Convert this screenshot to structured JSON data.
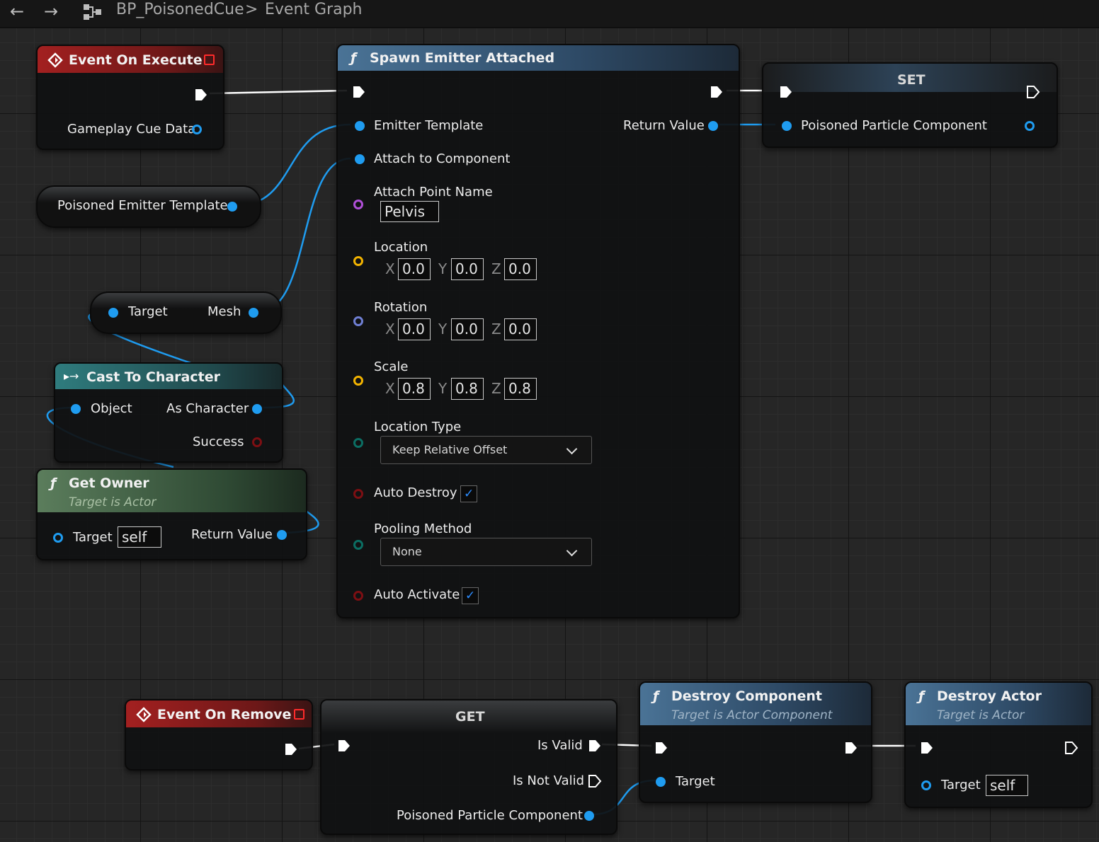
{
  "toolbar": {
    "back_icon": "arrow-left-icon",
    "forward_icon": "arrow-right-icon",
    "graph_icon": "blueprint-graph-icon",
    "blueprint": "BP_PoisonedCue",
    "separator": ">",
    "graph": "Event Graph"
  },
  "colors": {
    "event_header": "#8d1d1d",
    "function_header": "#3b5f7d",
    "pure_header": "#47604a",
    "cast_header": "#2f6a6c",
    "exec_pin": "#ffffff",
    "object_pin": "#1f9cf0",
    "vector_pin": "#f2b300",
    "rotator_pin": "#6f7fd3",
    "name_pin": "#b04fd8",
    "bool_pin": "#7d0f13",
    "enum_pin": "#0b6e63"
  },
  "event_exec": {
    "title": "Event On Execute",
    "pin": "Gameplay Cue Data"
  },
  "var_emitter": {
    "label": "Poisoned Emitter Template"
  },
  "mesh_node": {
    "target": "Target",
    "mesh": "Mesh"
  },
  "cast": {
    "title": "Cast To Character",
    "object": "Object",
    "as_character": "As Character",
    "success": "Success"
  },
  "get_owner": {
    "title": "Get Owner",
    "subtitle": "Target is Actor",
    "target": "Target",
    "target_value": "self",
    "return": "Return Value"
  },
  "spawn": {
    "title": "Spawn Emitter Attached",
    "emitter_template": "Emitter Template",
    "attach_component": "Attach to Component",
    "attach_point": "Attach Point Name",
    "attach_point_value": "Pelvis",
    "return": "Return Value",
    "axis_x": "X",
    "axis_y": "Y",
    "axis_z": "Z",
    "location": "Location",
    "loc_x": "0.0",
    "loc_y": "0.0",
    "loc_z": "0.0",
    "rotation": "Rotation",
    "rot_x": "0.0",
    "rot_y": "0.0",
    "rot_z": "0.0",
    "scale": "Scale",
    "sc_x": "0.8",
    "sc_y": "0.8",
    "sc_z": "0.8",
    "location_type": "Location Type",
    "location_type_value": "Keep Relative Offset",
    "auto_destroy": "Auto Destroy",
    "auto_destroy_checked": true,
    "pooling": "Pooling Method",
    "pooling_value": "None",
    "auto_activate": "Auto Activate",
    "auto_activate_checked": true
  },
  "set_node": {
    "title": "SET",
    "pin": "Poisoned Particle Component"
  },
  "event_remove": {
    "title": "Event On Remove"
  },
  "get_node": {
    "title": "GET",
    "is_valid": "Is Valid",
    "is_not_valid": "Is Not Valid",
    "pin": "Poisoned Particle Component"
  },
  "destroy_comp": {
    "title": "Destroy Component",
    "subtitle": "Target is Actor Component",
    "target": "Target"
  },
  "destroy_actor": {
    "title": "Destroy Actor",
    "subtitle": "Target is Actor",
    "target": "Target",
    "target_value": "self"
  }
}
